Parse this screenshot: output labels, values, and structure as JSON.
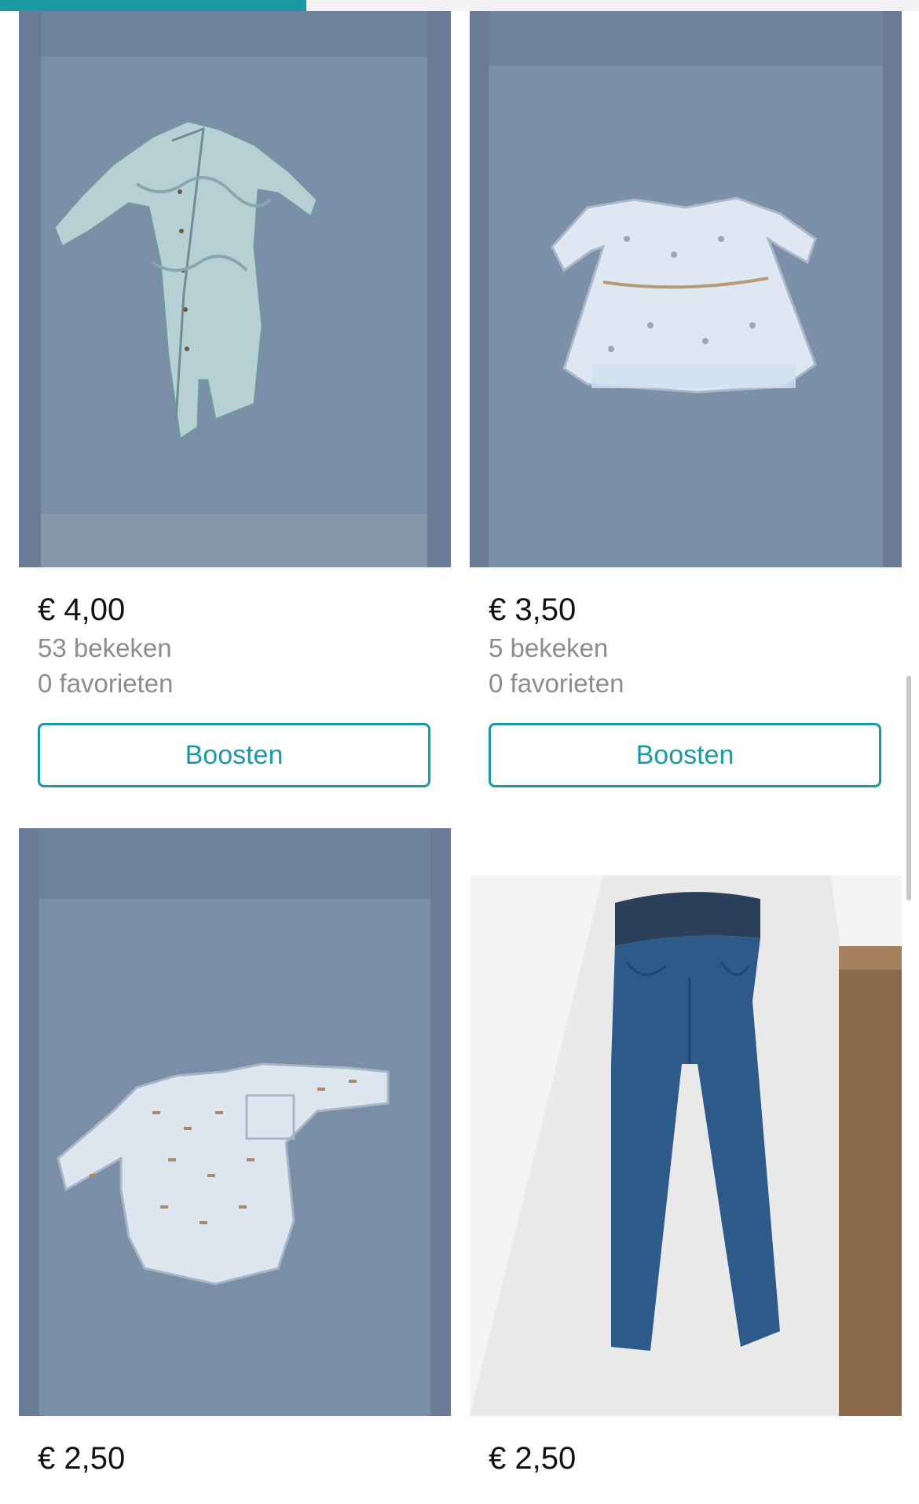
{
  "progress": {
    "fraction": 0.333
  },
  "listings": [
    {
      "item": "romper-photo",
      "price": "€ 4,00",
      "views": "53 bekeken",
      "favorites": "0 favorieten",
      "boost_label": "Boosten"
    },
    {
      "item": "dress-photo",
      "price": "€ 3,50",
      "views": "5 bekeken",
      "favorites": "0 favorieten",
      "boost_label": "Boosten"
    },
    {
      "item": "shirt-photo",
      "price": "€ 2,50"
    },
    {
      "item": "jeans-photo",
      "price": "€ 2,50"
    }
  ],
  "colors": {
    "accent": "#1b9aa4",
    "muted_text": "#8c8c8c",
    "blanket": "#7f94ad"
  }
}
